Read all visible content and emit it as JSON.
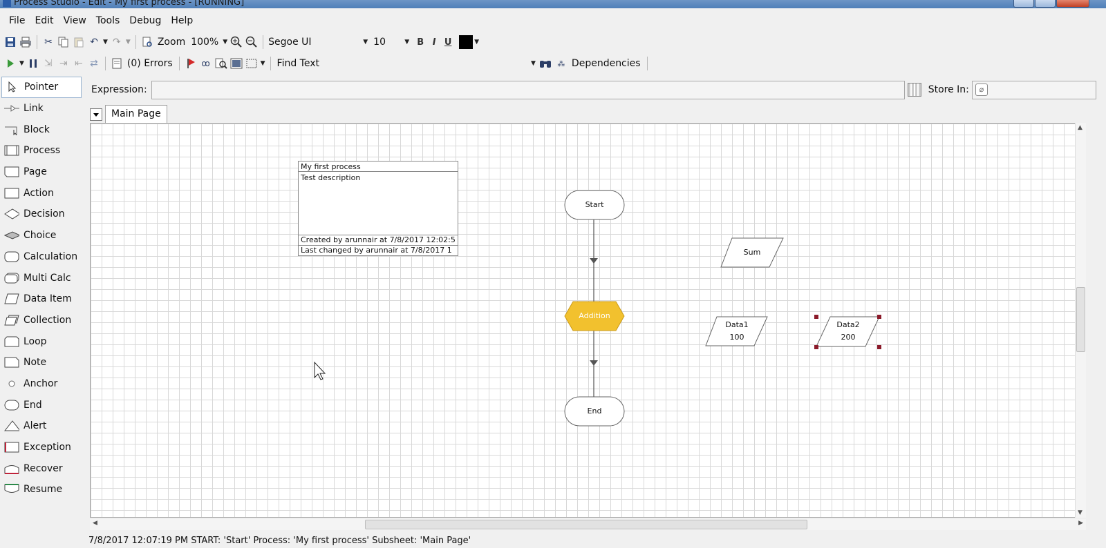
{
  "window": {
    "title": "Process Studio  - Edit - My first process - [RUNNING]"
  },
  "menu": [
    "File",
    "Edit",
    "View",
    "Tools",
    "Debug",
    "Help"
  ],
  "toolbar1": {
    "zoom_label": "Zoom",
    "zoom_value": "100%",
    "font_name": "Segoe UI",
    "font_size": "10",
    "bold": "B",
    "italic": "I",
    "underline": "U",
    "text_color": "#000000"
  },
  "toolbar2": {
    "errors_label": "(0) Errors",
    "find_label": "Find Text",
    "find_value": "",
    "dependencies_label": "Dependencies"
  },
  "palette": [
    {
      "label": "Pointer",
      "icon": "pointer-icon"
    },
    {
      "label": "Link",
      "icon": "link-icon"
    },
    {
      "label": "Block",
      "icon": "block-icon"
    },
    {
      "label": "Process",
      "icon": "process-icon"
    },
    {
      "label": "Page",
      "icon": "page-icon"
    },
    {
      "label": "Action",
      "icon": "action-icon"
    },
    {
      "label": "Decision",
      "icon": "decision-icon"
    },
    {
      "label": "Choice",
      "icon": "choice-icon"
    },
    {
      "label": "Calculation",
      "icon": "calculation-icon"
    },
    {
      "label": "Multi Calc",
      "icon": "multi-calc-icon"
    },
    {
      "label": "Data Item",
      "icon": "data-item-icon"
    },
    {
      "label": "Collection",
      "icon": "collection-icon"
    },
    {
      "label": "Loop",
      "icon": "loop-icon"
    },
    {
      "label": "Note",
      "icon": "note-icon"
    },
    {
      "label": "Anchor",
      "icon": "anchor-icon"
    },
    {
      "label": "End",
      "icon": "end-icon"
    },
    {
      "label": "Alert",
      "icon": "alert-icon"
    },
    {
      "label": "Exception",
      "icon": "exception-icon"
    },
    {
      "label": "Recover",
      "icon": "recover-icon"
    },
    {
      "label": "Resume",
      "icon": "resume-icon"
    }
  ],
  "expression": {
    "label": "Expression:",
    "value": "",
    "store_label": "Store In:",
    "store_value": ""
  },
  "tabs": [
    {
      "label": "Main Page"
    }
  ],
  "process_info": {
    "name": "My first process",
    "description": "Test description",
    "created": "Created by arunnair at 7/8/2017 12:02:5",
    "changed": "Last changed by arunnair at 7/8/2017 1"
  },
  "stages": {
    "start": "Start",
    "addition": "Addition",
    "end": "End",
    "sum": "Sum",
    "data1_name": "Data1",
    "data1_value": "100",
    "data2_name": "Data2",
    "data2_value": "200"
  },
  "colors": {
    "calculation_fill": "#f2c12e",
    "selection_handle": "#8b1a2a"
  },
  "status": "7/8/2017 12:07:19 PM START: 'Start' Process: 'My first process' Subsheet: 'Main Page'"
}
